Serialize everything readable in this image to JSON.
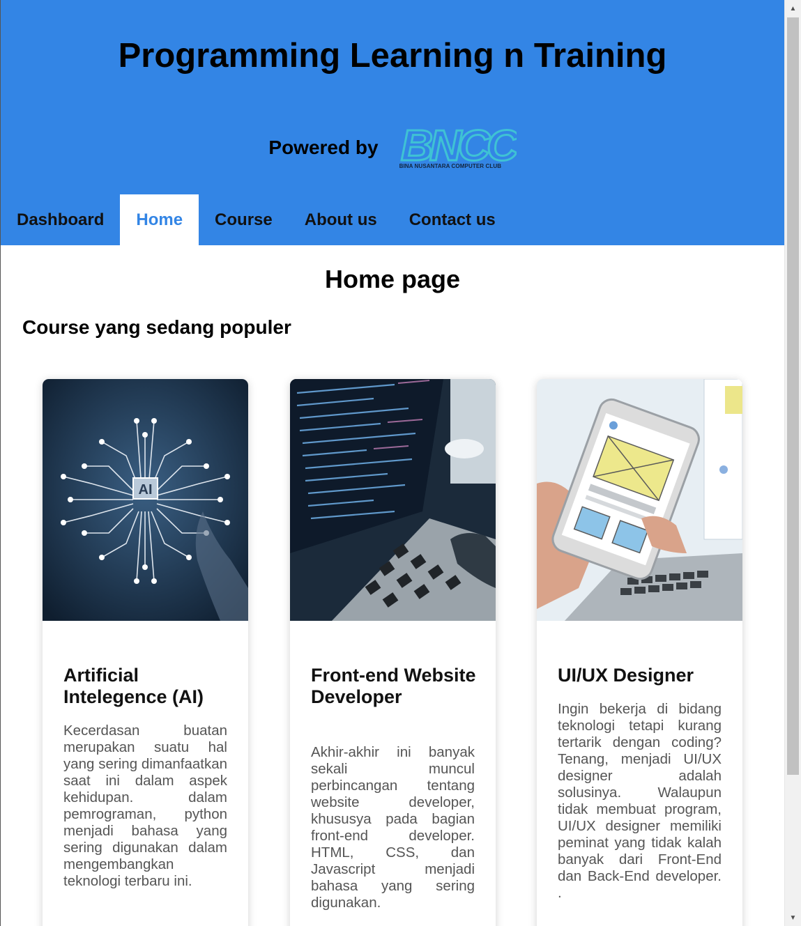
{
  "header": {
    "title": "Programming Learning n Training",
    "powered_label": "Powered by",
    "logo_text": "BNCC",
    "logo_subtext": "BINA NUSANTARA COMPUTER CLUB",
    "bg_color": "#3385e5"
  },
  "nav": {
    "tabs": [
      {
        "label": "Dashboard",
        "active": false
      },
      {
        "label": "Home",
        "active": true
      },
      {
        "label": "Course",
        "active": false
      },
      {
        "label": "About us",
        "active": false
      },
      {
        "label": "Contact us",
        "active": false
      }
    ]
  },
  "main": {
    "heading": "Home page",
    "section_title": "Course yang sedang populer",
    "cards": [
      {
        "title": "Artificial Intelegence (AI)",
        "description": "Kecerdasan buatan merupakan suatu hal yang sering dimanfaatkan saat ini dalam aspek kehidupan. dalam pemrograman, python menjadi bahasa yang sering digunakan dalam mengembangkan teknologi terbaru ini.",
        "image_icon": "ai-brain-image",
        "image_label": "AI"
      },
      {
        "title": "Front-end Website Developer",
        "description": "Akhir-akhir ini banyak sekali muncul perbincangan tentang website developer, khususya pada bagian front-end developer. HTML, CSS, dan Javascript menjadi bahasa yang sering digunakan.",
        "image_icon": "laptop-code-image"
      },
      {
        "title": "UI/UX Designer",
        "description": "Ingin bekerja di bidang teknologi tetapi kurang tertarik dengan coding? Tenang, menjadi UI/UX designer adalah solusinya. Walaupun tidak membuat program, UI/UX designer memiliki peminat yang tidak kalah banyak dari Front-End dan Back-End developer. .",
        "image_icon": "phone-wireframe-image"
      }
    ]
  },
  "scrollbar": {
    "up_icon": "scroll-up-arrow-icon",
    "down_icon": "scroll-down-arrow-icon"
  }
}
